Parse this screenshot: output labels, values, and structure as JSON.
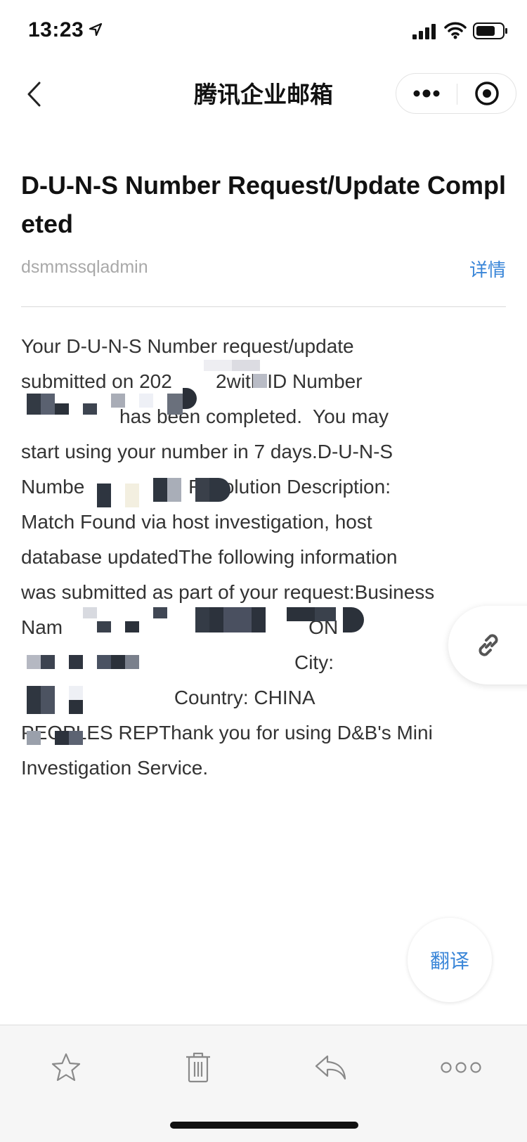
{
  "status_bar": {
    "time": "13:23"
  },
  "nav": {
    "title": "腾讯企业邮箱"
  },
  "email": {
    "subject": "D-U-N-S Number Request/Update Completed",
    "sender": "dsmmssqladmin",
    "details_label": "详情",
    "body_lines": [
      "Your D-U-N-S Number request/update",
      "submitted on 202        2with ID Number",
      "                  has been completed.  You may",
      "start using your number in 7 days.D-U-N-S",
      "Numbe                   Resolution Description:",
      "Match Found via host investigation, host",
      "database updatedThe following information",
      "was submitted as part of your request:Business",
      "Nam                                             ON",
      "",
      "                                                  City:",
      "                            Country: CHINA",
      "PEOPLES REPThank you for using D&B's Mini",
      "Investigation Service."
    ]
  },
  "fab": {
    "translate_label": "翻译"
  },
  "icons": {
    "back": "chevron-left-icon",
    "more": "more-dots-icon",
    "close": "target-close-icon",
    "link": "link-icon",
    "star": "star-icon",
    "trash": "trash-icon",
    "reply": "reply-icon",
    "menu": "more-circles-icon"
  },
  "colors": {
    "accent": "#3a86d8",
    "text": "#333333",
    "muted": "#a9a9a9"
  }
}
